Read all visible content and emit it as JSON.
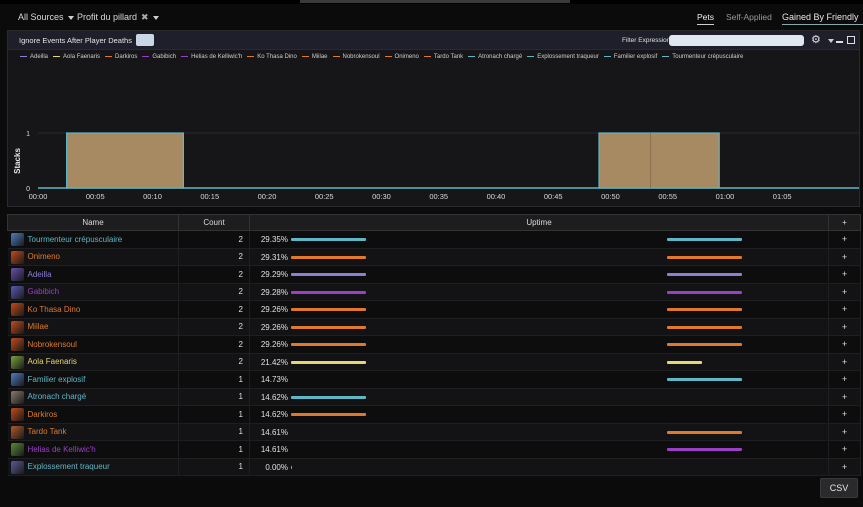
{
  "topbar": {
    "source": "All Sources",
    "ability": "Profit du pillard",
    "tabs": [
      "Pets",
      "Self-Applied"
    ],
    "gained": "Gained By Friendly"
  },
  "graph_toolbar": {
    "ignore": "Ignore Events After Player Deaths",
    "filter_label": "Filter Expression:",
    "filter_value": ""
  },
  "legend": [
    {
      "name": "Adeilla",
      "color": "#8b7fd6"
    },
    {
      "name": "Aola Faenaris",
      "color": "#e8d66e"
    },
    {
      "name": "Darkiros",
      "color": "#e07a2a"
    },
    {
      "name": "Gabibich",
      "color": "#9b3fc7"
    },
    {
      "name": "Helias de Kelliwic'h",
      "color": "#9b3fc7"
    },
    {
      "name": "Ko Thasa Dino",
      "color": "#e07a2a"
    },
    {
      "name": "Miilae",
      "color": "#e07a2a"
    },
    {
      "name": "Nobrokensoul",
      "color": "#e07a2a"
    },
    {
      "name": "Onimeno",
      "color": "#e07a2a"
    },
    {
      "name": "Tardo Tank",
      "color": "#e07a2a"
    },
    {
      "name": "Atronach chargé",
      "color": "#5fb6c6"
    },
    {
      "name": "Explossement traqueur",
      "color": "#5fb6c6"
    },
    {
      "name": "Familier explosif",
      "color": "#5fb6c6"
    },
    {
      "name": "Tourmenteur crépusculaire",
      "color": "#5fb6c6"
    }
  ],
  "chart_data": {
    "type": "area",
    "ylabel": "Stacks",
    "ylim": [
      0,
      1
    ],
    "yticks": [
      "0",
      "1"
    ],
    "xticks": [
      "00:00",
      "00:05",
      "00:10",
      "00:15",
      "00:20",
      "00:25",
      "00:30",
      "00:35",
      "00:40",
      "00:45",
      "00:50",
      "00:55",
      "01:00",
      "01:05"
    ],
    "xlim_seconds": [
      0,
      69
    ],
    "segments": [
      {
        "start": 2.5,
        "end": 12.7,
        "value": 1
      },
      {
        "start": 49.0,
        "end": 59.5,
        "value": 1
      }
    ]
  },
  "table": {
    "headers": {
      "name": "Name",
      "count": "Count",
      "uptime": "Uptime",
      "plus": "+"
    },
    "rows": [
      {
        "name": "Tourmenteur crépusculaire",
        "count": "2",
        "pct": "29.35%",
        "color": "#5fb6c6",
        "icon": "#4f7cc4",
        "bars": [
          [
            0.07,
            0.2
          ],
          [
            0.72,
            0.85
          ]
        ]
      },
      {
        "name": "Onimeno",
        "count": "2",
        "pct": "29.31%",
        "color": "#e07a2a",
        "icon": "#c44a1a",
        "bars": [
          [
            0.07,
            0.2
          ],
          [
            0.72,
            0.85
          ]
        ]
      },
      {
        "name": "Adeilla",
        "count": "2",
        "pct": "29.29%",
        "color": "#8b7fd6",
        "icon": "#6a4fb0",
        "bars": [
          [
            0.07,
            0.2
          ],
          [
            0.72,
            0.85
          ]
        ]
      },
      {
        "name": "Gabibich",
        "count": "2",
        "pct": "29.28%",
        "color": "#9b3fc7",
        "icon": "#5a5ab8",
        "bars": [
          [
            0.07,
            0.2
          ],
          [
            0.72,
            0.85
          ]
        ]
      },
      {
        "name": "Ko Thasa Dino",
        "count": "2",
        "pct": "29.26%",
        "color": "#e07a2a",
        "icon": "#c44a1a",
        "bars": [
          [
            0.07,
            0.2
          ],
          [
            0.72,
            0.85
          ]
        ]
      },
      {
        "name": "Miilae",
        "count": "2",
        "pct": "29.26%",
        "color": "#e07a2a",
        "icon": "#c44a1a",
        "bars": [
          [
            0.07,
            0.2
          ],
          [
            0.72,
            0.85
          ]
        ]
      },
      {
        "name": "Nobrokensoul",
        "count": "2",
        "pct": "29.26%",
        "color": "#e07a2a",
        "icon": "#c44a1a",
        "bars": [
          [
            0.07,
            0.2
          ],
          [
            0.72,
            0.85
          ]
        ]
      },
      {
        "name": "Aola Faenaris",
        "count": "2",
        "pct": "21.42%",
        "color": "#e8d66e",
        "icon": "#7aa33a",
        "bars": [
          [
            0.07,
            0.2
          ],
          [
            0.72,
            0.78
          ]
        ]
      },
      {
        "name": "Familier explosif",
        "count": "1",
        "pct": "14.73%",
        "color": "#5fb6c6",
        "icon": "#4f7cc4",
        "bars": [
          [
            0.72,
            0.85
          ]
        ]
      },
      {
        "name": "Atronach chargé",
        "count": "1",
        "pct": "14.62%",
        "color": "#5fb6c6",
        "icon": "#8a7a6a",
        "bars": [
          [
            0.07,
            0.2
          ]
        ]
      },
      {
        "name": "Darkiros",
        "count": "1",
        "pct": "14.62%",
        "color": "#e07a2a",
        "icon": "#c44a1a",
        "bars": [
          [
            0.07,
            0.2
          ]
        ]
      },
      {
        "name": "Tardo Tank",
        "count": "1",
        "pct": "14.61%",
        "color": "#e07a2a",
        "icon": "#b05a2a",
        "bars": [
          [
            0.72,
            0.85
          ]
        ]
      },
      {
        "name": "Helias de Kelliwic'h",
        "count": "1",
        "pct": "14.61%",
        "color": "#9b3fc7",
        "icon": "#5a8a3a",
        "bars": [
          [
            0.72,
            0.85
          ]
        ]
      },
      {
        "name": "Explossement traqueur",
        "count": "1",
        "pct": "0.00%",
        "color": "#5fb6c6",
        "icon": "#5a5a9a",
        "bars": [
          [
            0.07,
            0.072
          ]
        ]
      }
    ]
  },
  "csv_label": "CSV"
}
